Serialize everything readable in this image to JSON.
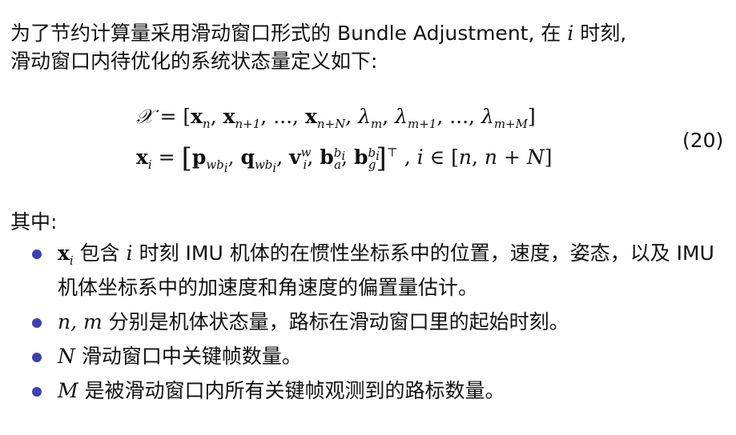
{
  "intro": {
    "line1_text": "为了节约计算量采用滑动窗口形式的 Bundle Adjustment, 在 ",
    "line1_var": "i",
    "line1_end": " 时刻,",
    "line2": "滑动窗口内待优化的系统状态量定义如下:"
  },
  "equations": {
    "eq1": {
      "lhs": "𝒳",
      "rhs": "= [x_n, x_{n+1}, ..., x_{n+N}, λ_m, λ_{m+1}, ..., λ_{m+M}]"
    },
    "eq2": {
      "lhs": "x_i",
      "rhs": "= [p_{wb_i}, q_{wb_i}, v_i^w, b_a^{b_i}, b_g^{b_i}]^⊤ , i ∈ [n, n + N]"
    },
    "number": "(20)"
  },
  "where_label": "其中:",
  "bullets": [
    {
      "var": "x",
      "var_sub": "i",
      "text": " 包含 ",
      "var2": "i",
      "text2": " 时刻 IMU 机体的在惯性坐标系中的位置，速度，姿态，以及 IMU 机体坐标系中的加速度和角速度的偏置量估计。"
    },
    {
      "var": "n, m",
      "text": " 分别是机体状态量，路标在滑动窗口里的起始时刻。"
    },
    {
      "var": "N",
      "text": " 滑动窗口中关键帧数量。"
    },
    {
      "var": "M",
      "text": " 是被滑动窗口内所有关键帧观测到的路标数量。"
    }
  ],
  "colors": {
    "text": "#111111",
    "bullet": "#3d3fb8"
  }
}
